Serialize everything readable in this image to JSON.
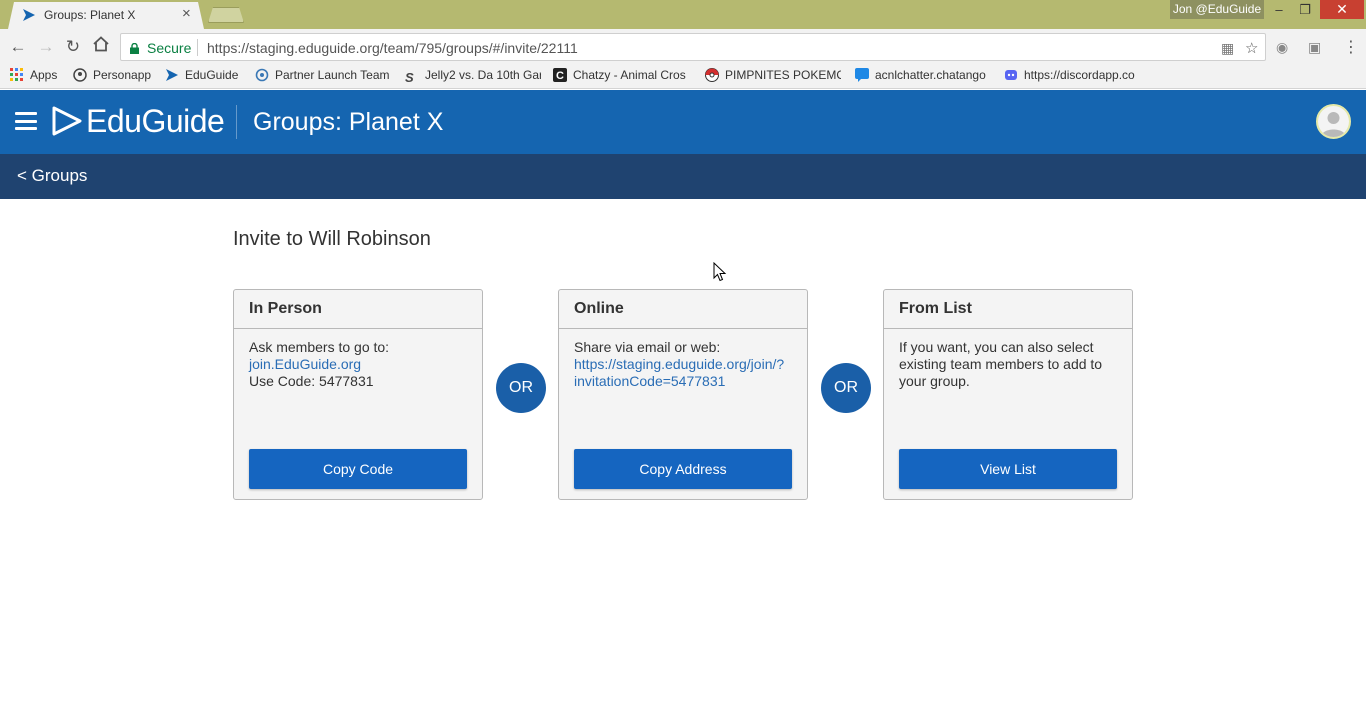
{
  "browser": {
    "tab_title": "Groups: Planet X",
    "profile": "Jon @EduGuide",
    "secure_label": "Secure",
    "url": "https://staging.eduguide.org/team/795/groups/#/invite/22111",
    "bookmarks": [
      {
        "label": "Apps",
        "icon": "apps-grid-icon"
      },
      {
        "label": "Personapp",
        "icon": "personapp-icon"
      },
      {
        "label": "EduGuide",
        "icon": "eduguide-icon"
      },
      {
        "label": "Partner Launch Team",
        "icon": "partner-launch-icon"
      },
      {
        "label": "Jelly2 vs. Da 10th Gar",
        "icon": "jelly-icon"
      },
      {
        "label": "Chatzy - Animal Cros",
        "icon": "chatzy-icon"
      },
      {
        "label": "PIMPNITES POKEMO",
        "icon": "pokeball-icon"
      },
      {
        "label": "acnlchatter.chatango",
        "icon": "chatango-icon"
      },
      {
        "label": "https://discordapp.co",
        "icon": "discord-icon"
      }
    ]
  },
  "header": {
    "logo_text": "EduGuide",
    "title": "Groups: Planet X"
  },
  "subnav": {
    "back_label": "< Groups"
  },
  "main": {
    "title": "Invite to Will Robinson",
    "or_label": "OR",
    "cards": [
      {
        "heading": "In Person",
        "line1": "Ask members to go to:",
        "link": "join.EduGuide.org",
        "line2": "Use Code: 5477831",
        "button": "Copy Code"
      },
      {
        "heading": "Online",
        "line1": "Share via email or web:",
        "link_part1": "https://staging.eduguide.org/join/?",
        "link_part2": "invitationCode=5477831",
        "button": "Copy Address"
      },
      {
        "heading": "From List",
        "line1": "If you want, you can also select",
        "line2": "existing team members to add to",
        "line3": "your group.",
        "button": "View List"
      }
    ]
  },
  "colors": {
    "header_blue": "#1565b0",
    "subnav_navy": "#1f4370",
    "button_blue": "#1565c0",
    "link_blue": "#2a6db5",
    "titlebar": "#b5b970"
  }
}
